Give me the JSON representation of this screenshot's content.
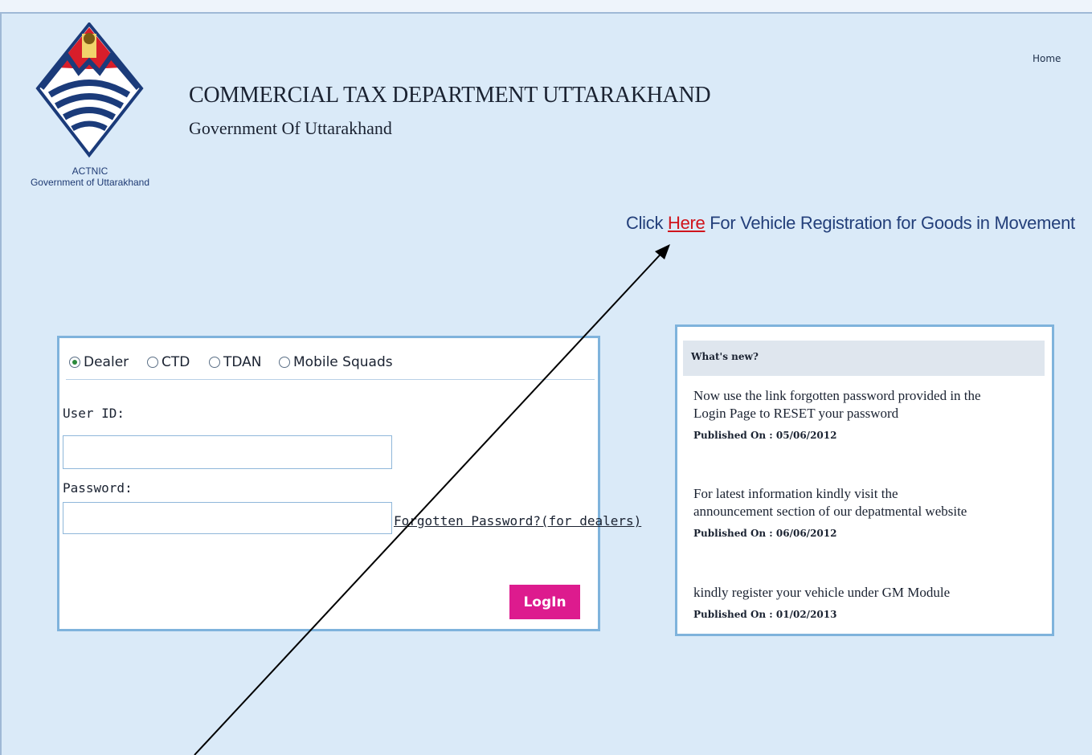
{
  "header": {
    "logo_caption_line1": "ACTNIC",
    "logo_caption_line2": "Government of Uttarakhand",
    "title": "COMMERCIAL TAX DEPARTMENT UTTARAKHAND",
    "subtitle": "Government Of Uttarakhand",
    "home_link": "Home"
  },
  "vehicle_notice": {
    "prefix": "Click ",
    "link": "Here",
    "suffix": " For Vehicle Registration for Goods in Movement"
  },
  "login": {
    "roles": [
      {
        "label": "Dealer",
        "selected": true
      },
      {
        "label": "CTD",
        "selected": false
      },
      {
        "label": "TDAN",
        "selected": false
      },
      {
        "label": "Mobile Squads",
        "selected": false
      }
    ],
    "user_id_label": "User ID:",
    "user_id_value": "",
    "password_label": "Password:",
    "password_value": "",
    "forgot_link": "Forgotten Password?(for dealers)",
    "login_button": "LogIn"
  },
  "news": {
    "heading": "What's new?",
    "items": [
      {
        "line1": "Now use the link forgotten password provided in the",
        "line2": "Login Page to RESET your password",
        "date": "Published On : 05/06/2012"
      },
      {
        "line1": "For latest information kindly visit the",
        "line2": "announcement section of our depatmental website",
        "date": "Published On : 06/06/2012"
      },
      {
        "line1": "kindly register your vehicle under GM Module",
        "line2": "",
        "date": "Published On : 01/02/2013"
      }
    ]
  },
  "colors": {
    "page_bg": "#daeaf8",
    "box_border": "#7fb3dc",
    "link_red": "#d0141c",
    "button_pink": "#dd1b8e",
    "notice_blue": "#233f7a"
  }
}
